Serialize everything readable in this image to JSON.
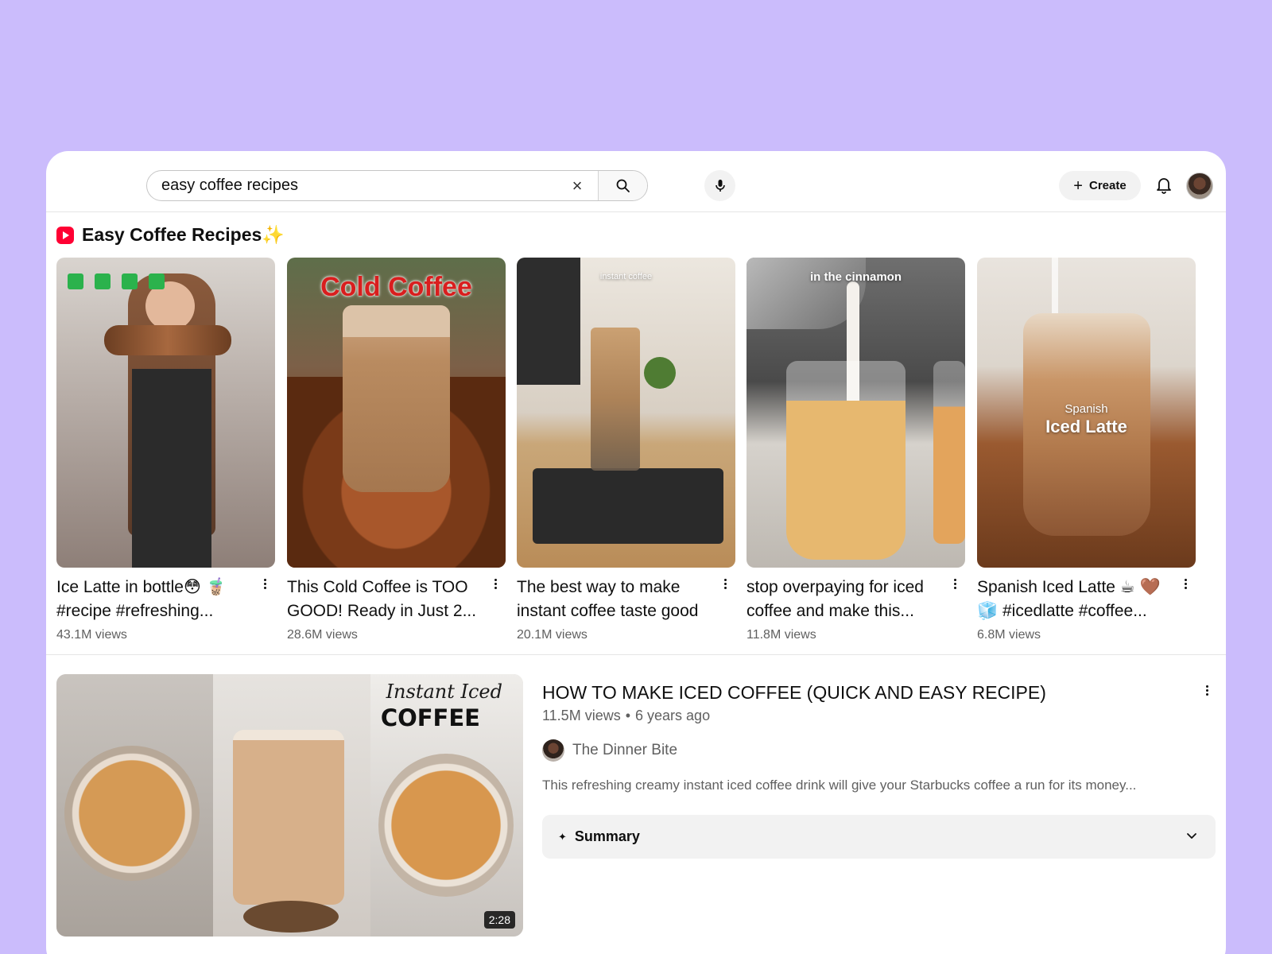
{
  "search": {
    "value": "easy coffee recipes",
    "clear_icon": "×"
  },
  "header": {
    "create_label": "Create",
    "create_plus": "+"
  },
  "shelf": {
    "title": "Easy Coffee Recipes",
    "title_emoji": "✨"
  },
  "shorts": [
    {
      "title": "Ice Latte in bottle😳 🧋 #recipe #refreshing...",
      "views": "43.1M views"
    },
    {
      "title": "This Cold Coffee is TOO GOOD! Ready in Just 2...",
      "views": "28.6M views",
      "overlay": "Cold Coffee"
    },
    {
      "title": "The best way to make instant coffee taste good",
      "views": "20.1M views",
      "overlay": "instant coffee"
    },
    {
      "title": "stop overpaying for iced coffee and make this...",
      "views": "11.8M views",
      "overlay": "in the cinnamon"
    },
    {
      "title": "Spanish Iced Latte ☕ 🤎 🧊 #icedlatte #coffee...",
      "views": "6.8M views",
      "overlay_small": "Spanish",
      "overlay": "Iced Latte"
    }
  ],
  "video": {
    "title": "HOW TO MAKE ICED COFFEE (QUICK AND EASY RECIPE)",
    "views": "11.5M views",
    "separator": "•",
    "age": "6 years ago",
    "channel": "The Dinner Bite",
    "description": "This refreshing creamy instant iced coffee drink will give your Starbucks coffee a run for its money...",
    "duration": "2:28",
    "thumb_script": "Instant Iced",
    "thumb_word": "COFFEE",
    "summary_label": "Summary",
    "summary_icon": "✦"
  },
  "colors": {
    "background": "#cbbcfc",
    "shorts_red": "#ff0033",
    "meta_grey": "#606060"
  }
}
